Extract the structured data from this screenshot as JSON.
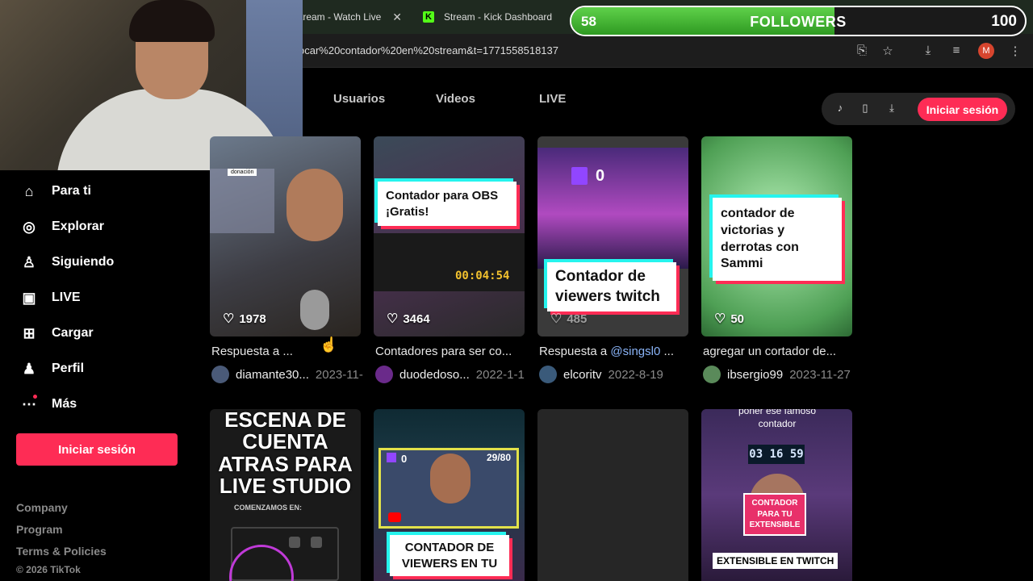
{
  "browser": {
    "tabs": [
      {
        "label": "tream - Watch Live",
        "close": "✕"
      },
      {
        "label": "Stream - Kick Dashboard"
      }
    ],
    "url": "ocar%20contador%20en%20stream&t=1771558518137",
    "profile_initial": "M"
  },
  "overlay": {
    "count": "58",
    "label": "FOLLOWERS",
    "goal": "100",
    "progress": 0.58
  },
  "nav": {
    "links": [
      "Usuarios",
      "Videos",
      "LIVE"
    ],
    "login": "Iniciar sesión"
  },
  "sidebar": {
    "items": [
      {
        "label": "Para ti",
        "icon": "home-icon"
      },
      {
        "label": "Explorar",
        "icon": "compass-icon"
      },
      {
        "label": "Siguiendo",
        "icon": "following-icon"
      },
      {
        "label": "LIVE",
        "icon": "live-tv-icon"
      },
      {
        "label": "Cargar",
        "icon": "upload-plus-icon"
      },
      {
        "label": "Perfil",
        "icon": "profile-icon"
      },
      {
        "label": "Más",
        "icon": "more-dots-icon"
      }
    ],
    "login": "Iniciar sesión",
    "footer": [
      "Company",
      "Program",
      "Terms & Policies"
    ],
    "copyright": "© 2026 TikTok"
  },
  "videos": [
    {
      "likes": "1978",
      "caption": "Respuesta a ...",
      "author": "diamante30...",
      "date": "2023-11-",
      "thumb_text": "donación"
    },
    {
      "likes": "3464",
      "caption": "Contadores para ser co...",
      "author": "duodedoso...",
      "date": "2022-1-1",
      "thumb_text": "Contador para OBS ¡Gratis!",
      "timer": "00:04:54"
    },
    {
      "likes": "485",
      "caption_prefix": "Respuesta a ",
      "mention": "@singsl0",
      "caption_suffix": " ...",
      "author": "elcoritv",
      "date": "2022-8-19",
      "thumb_text": "Contador de viewers twitch",
      "counter": "0"
    },
    {
      "likes": "50",
      "caption": "agregar un cortador de...",
      "author": "ibsergio99",
      "date": "2023-11-27",
      "thumb_text": "contador de victorias y derrotas con Sammi"
    },
    {
      "thumb_text": "ESCENA DE CUENTA ATRAS PARA LIVE STUDIO",
      "sub_text": "COMENZAMOS EN:"
    },
    {
      "thumb_text": "CONTADOR DE VIEWERS EN TU",
      "viewers": "29/80",
      "counter": "0"
    },
    {},
    {
      "top_text": "poner ese famoso contador",
      "timer": "03 16 59",
      "badge_text": "CONTADOR PARA TU EXTENSIBLE",
      "bottom_text": "EXTENSIBLE EN TWITCH"
    }
  ]
}
